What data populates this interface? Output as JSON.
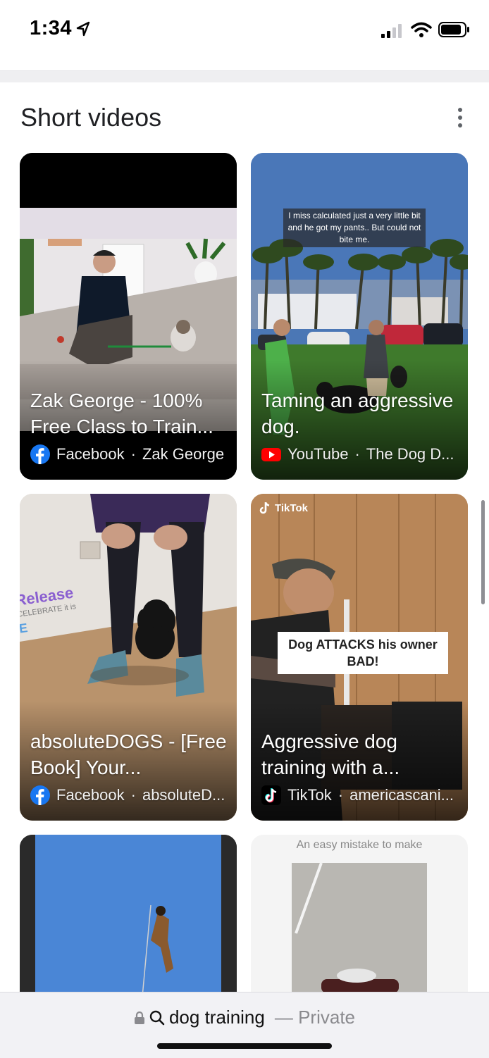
{
  "status_bar": {
    "time": "1:34"
  },
  "section": {
    "title": "Short videos"
  },
  "cards": [
    {
      "title": "Zak George - 100% Free Class to Train...",
      "source": "Facebook",
      "author": "Zak George",
      "source_icon": "facebook-icon"
    },
    {
      "title": "Taming an aggressive dog.",
      "source": "YouTube",
      "author": "The Dog D...",
      "source_icon": "youtube-icon",
      "thumbnail_caption": "I miss calculated just a very little bit and he got my pants.. But could not bite me."
    },
    {
      "title": "absoluteDOGS - [Free Book] Your...",
      "source": "Facebook",
      "author": "absoluteD...",
      "source_icon": "facebook-icon",
      "thumbnail_text": [
        "Release",
        "CELEBRATE it is",
        "E"
      ]
    },
    {
      "title": "Aggressive dog training with a...",
      "source": "TikTok",
      "author": "americascani...",
      "source_icon": "tiktok-icon",
      "thumbnail_watermark": "TikTok",
      "thumbnail_caption": "Dog ATTACKS his owner BAD!"
    },
    {
      "title": "",
      "source": "",
      "author": ""
    },
    {
      "title": "",
      "source": "",
      "author": "",
      "thumbnail_caption": "An easy mistake to make"
    }
  ],
  "bottom_bar": {
    "query": "dog training",
    "mode": "— Private"
  },
  "colors": {
    "facebook": "#1877f2",
    "youtube": "#ff0000",
    "tiktok": "#000000"
  }
}
